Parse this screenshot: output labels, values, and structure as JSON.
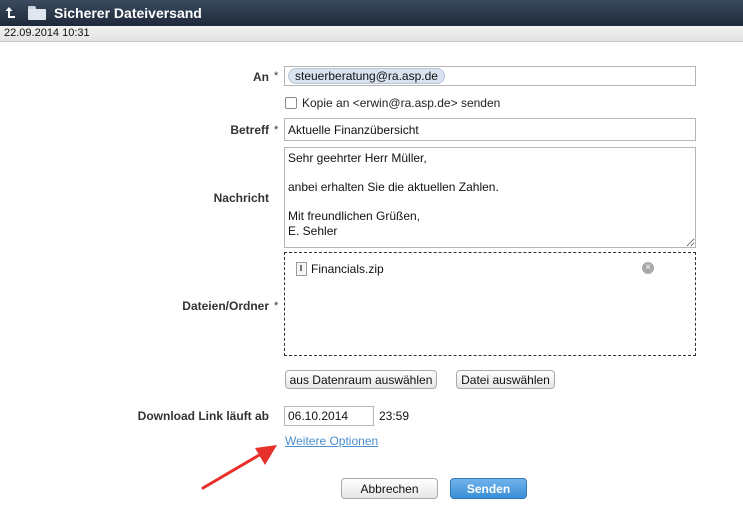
{
  "window": {
    "title": "Sicherer Dateiversand"
  },
  "datebar": {
    "timestamp": "22.09.2014 10:31"
  },
  "form": {
    "to": {
      "label": "An",
      "required": "*",
      "recipient": "steuerberatung@ra.asp.de"
    },
    "copy": {
      "label": "Kopie an <erwin@ra.asp.de> senden",
      "checked": false
    },
    "subject": {
      "label": "Betreff",
      "required": "*",
      "value": "Aktuelle Finanzübersicht"
    },
    "message": {
      "label": "Nachricht",
      "value": "Sehr geehrter Herr Müller,\n\nanbei erhalten Sie die aktuellen Zahlen.\n\nMit freundlichen Grüßen,\nE. Sehler"
    },
    "files": {
      "label": "Dateien/Ordner",
      "required": "*",
      "items": [
        {
          "name": "Financials.zip",
          "remove_icon": "remove-circle-icon"
        }
      ]
    },
    "buttons": {
      "from_dataroom": "aus Datenraum auswählen",
      "choose_file": "Datei auswählen"
    },
    "expiry": {
      "label": "Download Link läuft ab",
      "date": "06.10.2014",
      "time": "23:59"
    },
    "more_options": "Weitere Optionen",
    "cancel": "Abbrechen",
    "send": "Senden"
  },
  "colors": {
    "accent": "#3a8ed6",
    "link": "#4a8fd0",
    "annotation_arrow": "#e8302a",
    "titlebar": "#1e2a3a"
  }
}
